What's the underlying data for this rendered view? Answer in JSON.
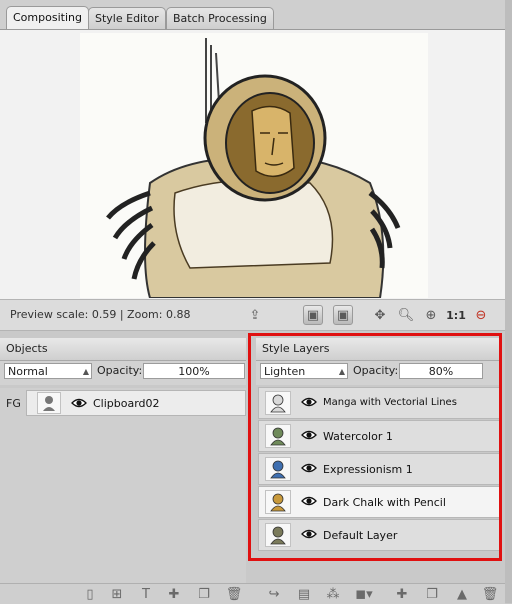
{
  "tabs": [
    {
      "label": "Compositing",
      "active": true
    },
    {
      "label": "Style Editor",
      "active": false
    },
    {
      "label": "Batch Processing",
      "active": false
    }
  ],
  "preview": {
    "status": "Preview scale: 0.59  |  Zoom: 0.88",
    "zoom_actual_label": "1:1"
  },
  "objects_panel": {
    "title": "Objects",
    "blend_mode": "Normal",
    "opacity_label": "Opacity:",
    "opacity_value": "100%",
    "rows": [
      {
        "group": "FG",
        "name": "Clipboard02"
      }
    ]
  },
  "style_layers_panel": {
    "title": "Style Layers",
    "blend_mode": "Lighten",
    "opacity_label": "Opacity:",
    "opacity_value": "80%",
    "layers": [
      {
        "name": "Manga with Vectorial Lines",
        "tint": "#d9d9d9",
        "selected": false
      },
      {
        "name": "Watercolor 1",
        "tint": "#6f8a5a",
        "selected": false
      },
      {
        "name": "Expressionism 1",
        "tint": "#3f6fb0",
        "selected": false
      },
      {
        "name": "Dark Chalk with Pencil",
        "tint": "#c99a3b",
        "selected": true
      },
      {
        "name": "Default Layer",
        "tint": "#7a7a5a",
        "selected": false
      }
    ]
  },
  "colors": {
    "highlight_frame": "#e01010"
  },
  "icons": {
    "preview_toolbar": [
      "export-icon",
      "camera-icon",
      "camera-stack-icon",
      "move-icon",
      "zoom-out-icon",
      "zoom-in-icon",
      "zoom-1-1-icon",
      "zoom-minus-icon"
    ],
    "objects_toolbar": [
      "doc-icon",
      "frame-icon",
      "text-icon",
      "add-icon",
      "duplicate-icon",
      "trash-icon"
    ],
    "layers_toolbar": [
      "redo-icon",
      "save-icon",
      "nodes-icon",
      "cube-menu-icon",
      "add-icon",
      "duplicate-icon",
      "stamp-icon",
      "trash-icon"
    ]
  }
}
